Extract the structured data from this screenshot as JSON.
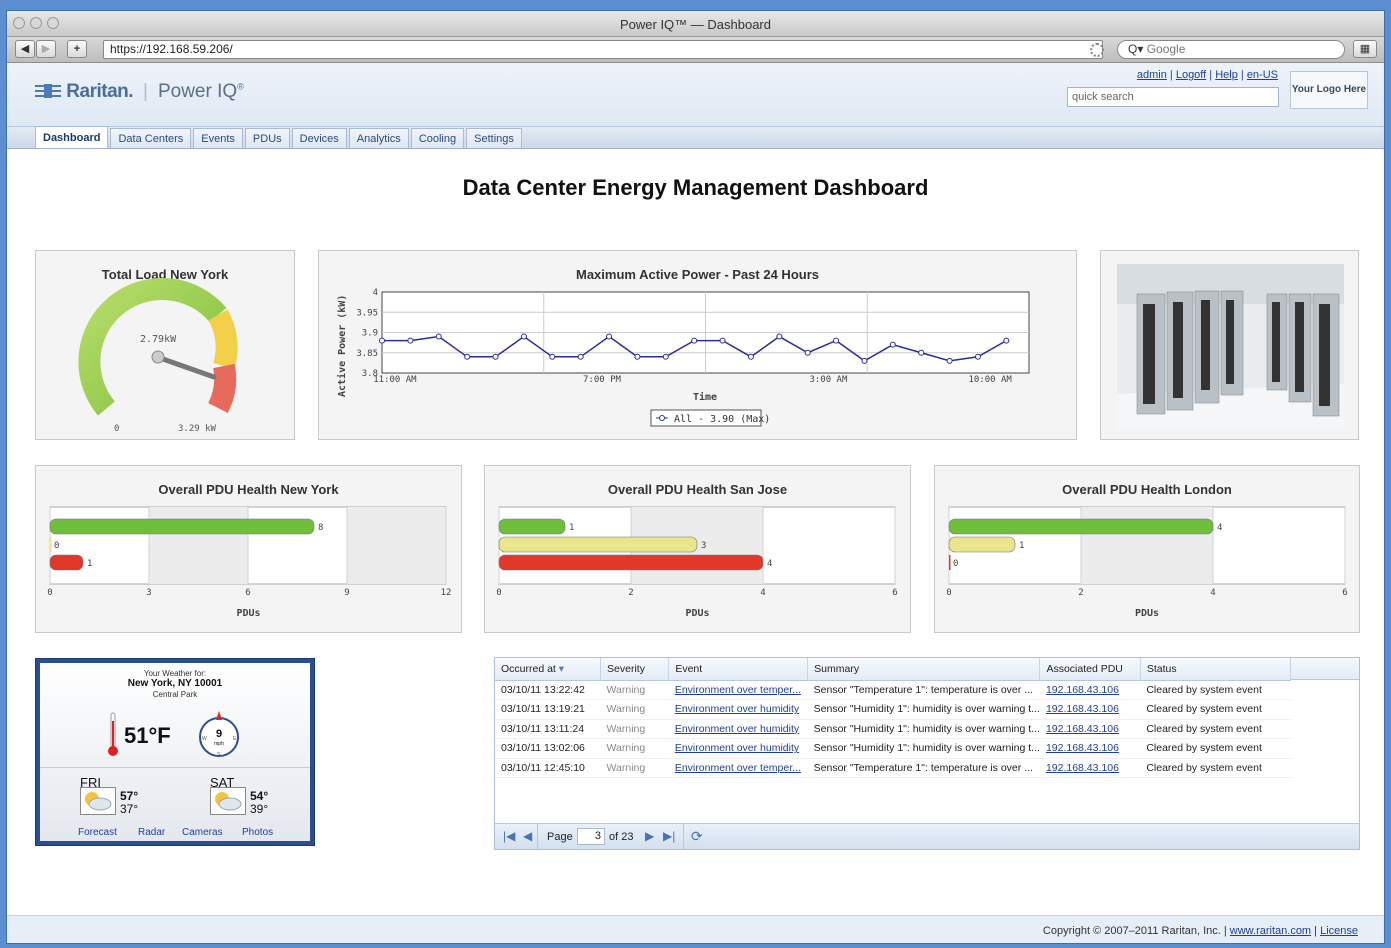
{
  "window": {
    "title": "Power IQ™ — Dashboard"
  },
  "browser": {
    "url": "https://192.168.59.206/",
    "search_placeholder": "Google",
    "nav_back": "◀",
    "nav_fwd": "▶",
    "add": "+"
  },
  "header": {
    "brand": "Raritan.",
    "product": "Power IQ",
    "product_mark": "®",
    "links": {
      "admin": "admin",
      "logoff": "Logoff",
      "help": "Help",
      "locale": "en-US"
    },
    "quick_search_placeholder": "quick search",
    "logo_box": "Your Logo Here"
  },
  "tabs": [
    "Dashboard",
    "Data Centers",
    "Events",
    "PDUs",
    "Devices",
    "Analytics",
    "Cooling",
    "Settings"
  ],
  "page_title": "Data Center Energy Management Dashboard",
  "gauge": {
    "title": "Total Load New York",
    "value_label": "2.79kW",
    "min_label": "0",
    "max_label": "3.29 kW",
    "value": 2.79,
    "max": 3.29
  },
  "chart_data": [
    {
      "type": "line",
      "title": "Maximum Active Power - Past 24 Hours",
      "xlabel": "Time",
      "ylabel": "Active Power (kW)",
      "ylim": [
        3.8,
        4
      ],
      "yticks": [
        "4",
        "3.95",
        "3.9",
        "3.85",
        "3.8"
      ],
      "xticks": [
        "11:00 AM",
        "7:00 PM",
        "3:00 AM",
        "10:00 AM"
      ],
      "legend": "All - 3.90 (Max)",
      "grid": true,
      "series": [
        {
          "name": "All",
          "values": [
            3.88,
            3.88,
            3.89,
            3.84,
            3.84,
            3.89,
            3.84,
            3.84,
            3.89,
            3.84,
            3.84,
            3.88,
            3.88,
            3.84,
            3.89,
            3.85,
            3.88,
            3.83,
            3.87,
            3.85,
            3.83,
            3.84,
            3.88
          ]
        }
      ]
    },
    {
      "type": "bar",
      "title": "Overall PDU Health New York",
      "xlabel": "PDUs",
      "xticks": [
        "0",
        "3",
        "6",
        "9",
        "12"
      ],
      "xlim": [
        0,
        12
      ],
      "values": [
        8,
        0,
        1
      ],
      "labels": [
        "8",
        "0",
        "1"
      ],
      "colors": [
        "#6fbe3c",
        "#e9e58a",
        "#e2382b"
      ]
    },
    {
      "type": "bar",
      "title": "Overall PDU Health San Jose",
      "xlabel": "PDUs",
      "xticks": [
        "0",
        "2",
        "4",
        "6"
      ],
      "xlim": [
        0,
        6
      ],
      "values": [
        1,
        3,
        4
      ],
      "labels": [
        "1",
        "3",
        "4"
      ],
      "colors": [
        "#6fbe3c",
        "#e9e58a",
        "#e2382b"
      ]
    },
    {
      "type": "bar",
      "title": "Overall PDU Health London",
      "xlabel": "PDUs",
      "xticks": [
        "0",
        "2",
        "4",
        "6"
      ],
      "xlim": [
        0,
        6
      ],
      "values": [
        4,
        1,
        0
      ],
      "labels": [
        "4",
        "1",
        "0"
      ],
      "colors": [
        "#6fbe3c",
        "#e9e58a",
        "#e2382b"
      ]
    }
  ],
  "weather": {
    "heading": "Your Weather for:",
    "location": "New York, NY 10001",
    "sublocation": "Central Park",
    "temp": "51°F",
    "wind_speed": "9",
    "wind_unit": "mph",
    "days": [
      {
        "day": "FRI",
        "high": "57°",
        "low": "37°"
      },
      {
        "day": "SAT",
        "high": "54°",
        "low": "39°"
      }
    ],
    "links": [
      "Forecast",
      "Radar",
      "Cameras",
      "Photos"
    ]
  },
  "events": {
    "columns": [
      "Occurred at",
      "Severity",
      "Event",
      "Summary",
      "Associated PDU",
      "Status"
    ],
    "rows": [
      [
        "03/10/11 13:22:42",
        "Warning",
        "Environment over temper...",
        "Sensor \"Temperature 1\": temperature is over ...",
        "192.168.43.106",
        "Cleared by system event"
      ],
      [
        "03/10/11 13:19:21",
        "Warning",
        "Environment over humidity",
        "Sensor \"Humidity 1\": humidity is over warning t...",
        "192.168.43.106",
        "Cleared by system event"
      ],
      [
        "03/10/11 13:11:24",
        "Warning",
        "Environment over humidity",
        "Sensor \"Humidity 1\": humidity is over warning t...",
        "192.168.43.106",
        "Cleared by system event"
      ],
      [
        "03/10/11 13:02:06",
        "Warning",
        "Environment over humidity",
        "Sensor \"Humidity 1\": humidity is over warning t...",
        "192.168.43.106",
        "Cleared by system event"
      ],
      [
        "03/10/11 12:45:10",
        "Warning",
        "Environment over temper...",
        "Sensor \"Temperature 1\": temperature is over ...",
        "192.168.43.106",
        "Cleared by system event"
      ]
    ],
    "pager": {
      "page_label": "Page",
      "page": "3",
      "of_label": "of 23"
    }
  },
  "footer": {
    "copyright": "Copyright © 2007–2011 Raritan, Inc. |",
    "site": "www.raritan.com",
    "sep": "|",
    "license": "License"
  }
}
